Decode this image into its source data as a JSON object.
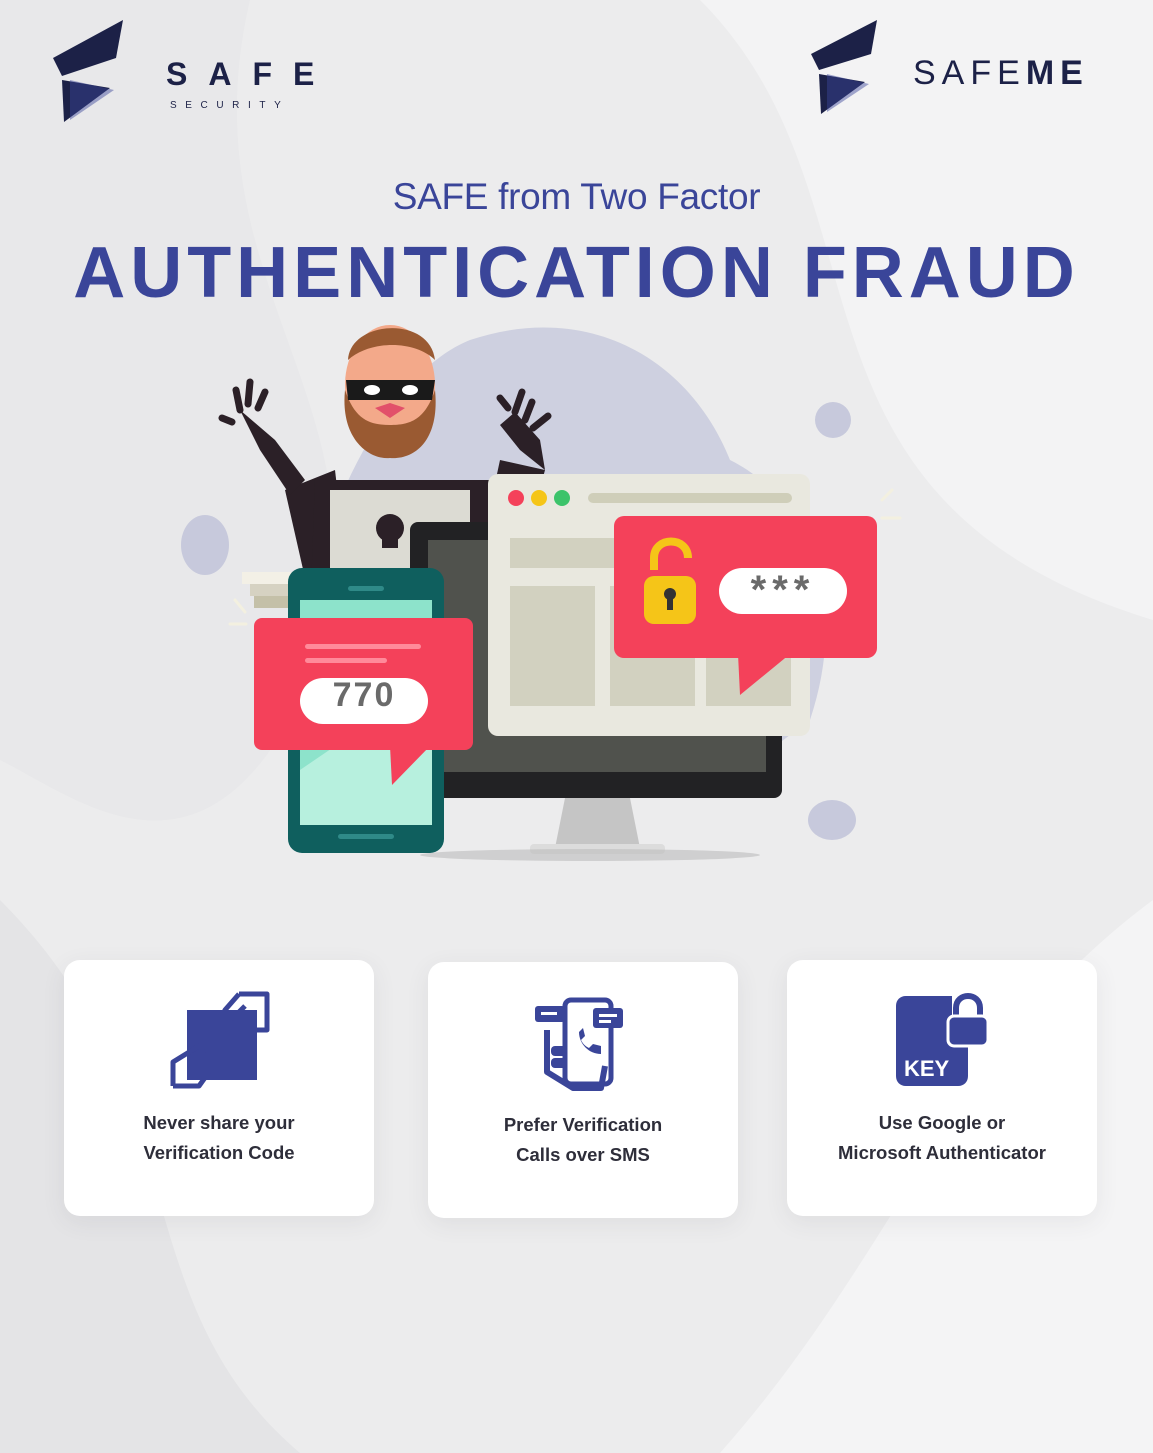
{
  "logo_left": {
    "word": "SAFE",
    "sub": "SECURITY"
  },
  "logo_right": {
    "word_a": "SAFE",
    "word_b": "ME"
  },
  "subtitle": "SAFE from Two Factor",
  "title": "AUTHENTICATION FRAUD",
  "illustration": {
    "otp_code": "770",
    "password_mask": "***",
    "icons": [
      "hacker",
      "smartphone",
      "monitor",
      "browser-window",
      "open-padlock-icon",
      "message-bubble"
    ]
  },
  "tips": [
    {
      "icon": "hand-share-icon",
      "line1": "Never share your",
      "line2": "Verification Code"
    },
    {
      "icon": "phone-call-chat-icon",
      "line1": "Prefer Verification",
      "line2": "Calls over SMS"
    },
    {
      "icon": "key-file-lock-icon",
      "line1": "Use Google or",
      "line2": "Microsoft Authenticator"
    }
  ],
  "colors": {
    "primary": "#3a4599",
    "navy": "#1c2147",
    "alert_red": "#f4415a",
    "padlock_yellow": "#f5c518",
    "phone_teal": "#0f5f5e",
    "background": "#ececed"
  }
}
